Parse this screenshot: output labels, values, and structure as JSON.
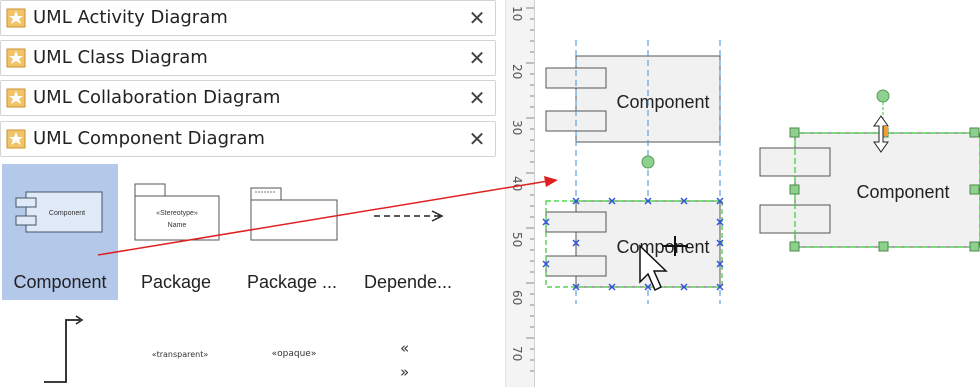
{
  "libraries": [
    {
      "label": "UML Activity Diagram"
    },
    {
      "label": "UML Class Diagram"
    },
    {
      "label": "UML Collaboration Diagram"
    },
    {
      "label": "UML Component Diagram"
    }
  ],
  "shapes_row1": [
    {
      "label": "Component",
      "selected": true,
      "thumb_text": "Component"
    },
    {
      "label": "Package",
      "thumb_text1": "«Stereotype»",
      "thumb_text2": "Name"
    },
    {
      "label": "Package ...",
      "thumb_text": ""
    },
    {
      "label": "Depende..."
    }
  ],
  "shapes_row2": [
    {
      "text": ""
    },
    {
      "text": "«transparent»"
    },
    {
      "text": "«opaque»"
    },
    {
      "text": "«\n»"
    }
  ],
  "ruler": {
    "ticks": [
      "10",
      "20",
      "30",
      "40",
      "50",
      "60",
      "70"
    ]
  },
  "canvas": {
    "component_top_label": "Component",
    "component_drag_label": "Component",
    "component_right_label": "Component"
  },
  "colors": {
    "selection": "#b4c8ea",
    "guide": "#3b8fd8",
    "handle": "#7cd07c",
    "drag_arrow": "#e02020"
  }
}
